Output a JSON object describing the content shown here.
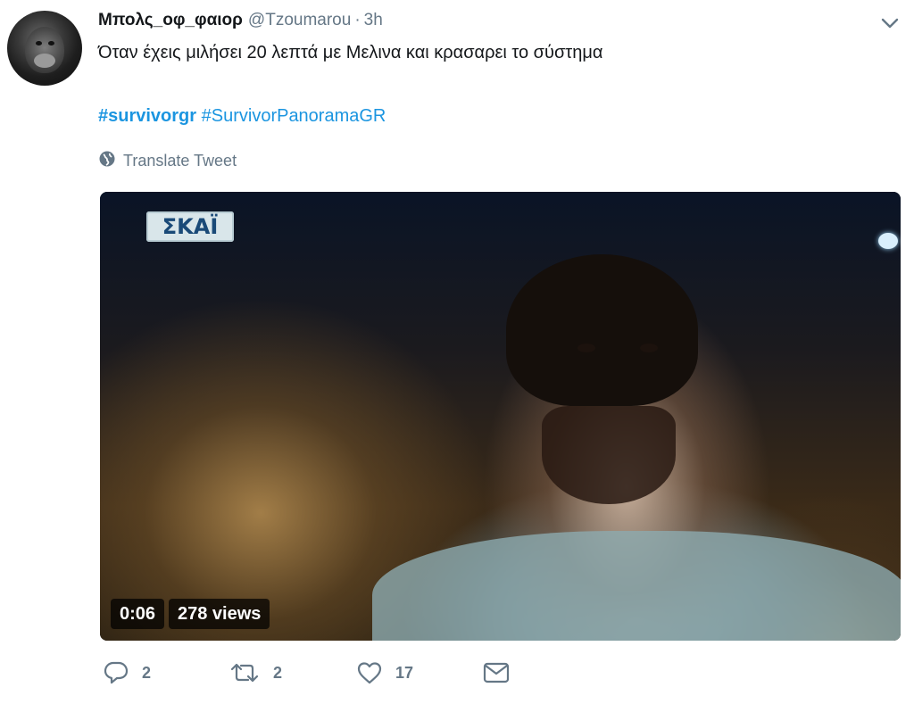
{
  "tweet": {
    "display_name": "Μπολς_οφ_φαιορ",
    "handle": "@Tzoumarou",
    "separator": "·",
    "time": "3h",
    "text": "Όταν έχεις μιλήσει 20 λεπτά με Μελινα και κρασαρει το σύστημα",
    "hashtags": [
      "#survivorgr",
      "#SurvivorPanoramaGR"
    ],
    "translate_label": "Translate Tweet"
  },
  "media": {
    "channel_logo": "ΣΚΑΪ",
    "duration": "0:06",
    "views": "278 views"
  },
  "actions": {
    "replies": "2",
    "retweets": "2",
    "likes": "17"
  },
  "colors": {
    "link": "#1b95e0",
    "muted": "#657786",
    "text": "#14171a"
  },
  "icons": [
    "chevron-down-icon",
    "globe-icon",
    "reply-icon",
    "retweet-icon",
    "heart-icon",
    "dm-icon"
  ]
}
